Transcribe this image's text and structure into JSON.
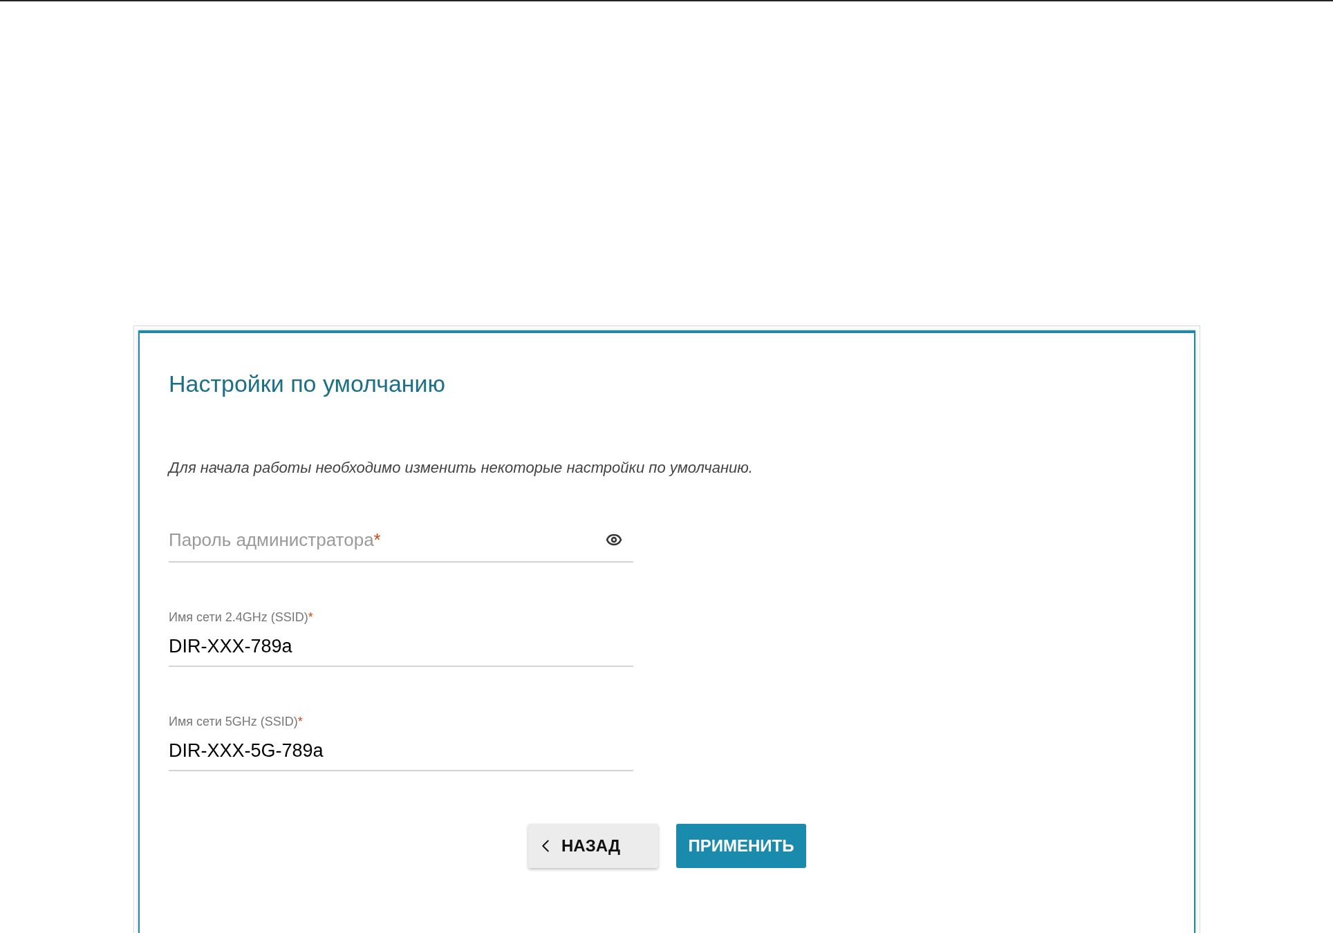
{
  "title": "Настройки по умолчанию",
  "description": "Для начала работы необходимо изменить некоторые настройки по умолчанию.",
  "fields": [
    {
      "kind": "password",
      "placeholder": "Пароль администратора",
      "required_mark": "*"
    },
    {
      "kind": "text",
      "label": "Имя сети 2.4GHz (SSID)",
      "required_mark": "*",
      "value": "DIR-XXX-789a"
    },
    {
      "kind": "text",
      "label": "Имя сети 5GHz (SSID)",
      "required_mark": "*",
      "value": "DIR-XXX-5G-789a"
    }
  ],
  "buttons": [
    {
      "kind": "back",
      "label": "НАЗАД"
    },
    {
      "kind": "primary",
      "label": "ПРИМЕНИТЬ"
    }
  ]
}
